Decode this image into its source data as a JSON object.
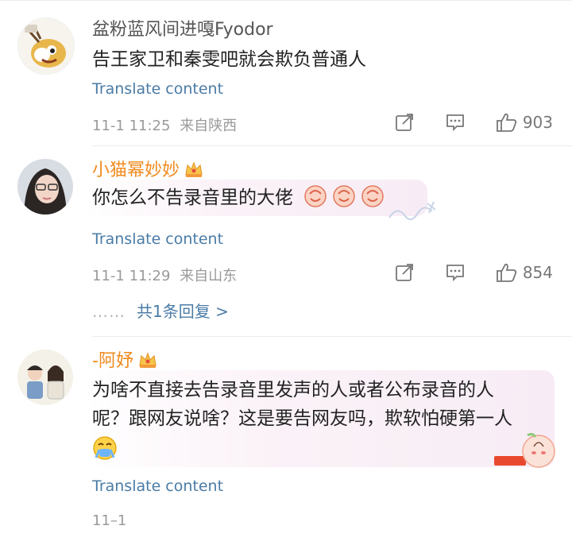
{
  "comments": [
    {
      "username": "盆粉蓝风间进嘎Fyodor",
      "text": "告王家卫和秦雯吧就会欺负普通人",
      "translate": "Translate content",
      "time": "11-1 11:25",
      "location": "来自陕西",
      "likes": "903"
    },
    {
      "username": "小猫幂妙妙",
      "text": "你怎么不告录音里的大佬",
      "translate": "Translate content",
      "time": "11-1 11:29",
      "location": "来自山东",
      "likes": "854",
      "dots": "……",
      "replies": "共1条回复 >"
    },
    {
      "username": "-阿妤",
      "text_line1": "为啥不直接去告录音里发声的人或者公布录音的人",
      "text_line2": "呢？跟网友说啥？这是要告网友吗，欺软怕硬第一人",
      "translate": "Translate content",
      "time": "11–1"
    }
  ],
  "colors": {
    "link": "#4a7ba6",
    "vip_name": "#f08a1d",
    "meta": "#9a9a9a"
  },
  "icons": [
    "forward-icon",
    "comment-icon",
    "like-icon",
    "crown-icon",
    "emoji-icon"
  ]
}
